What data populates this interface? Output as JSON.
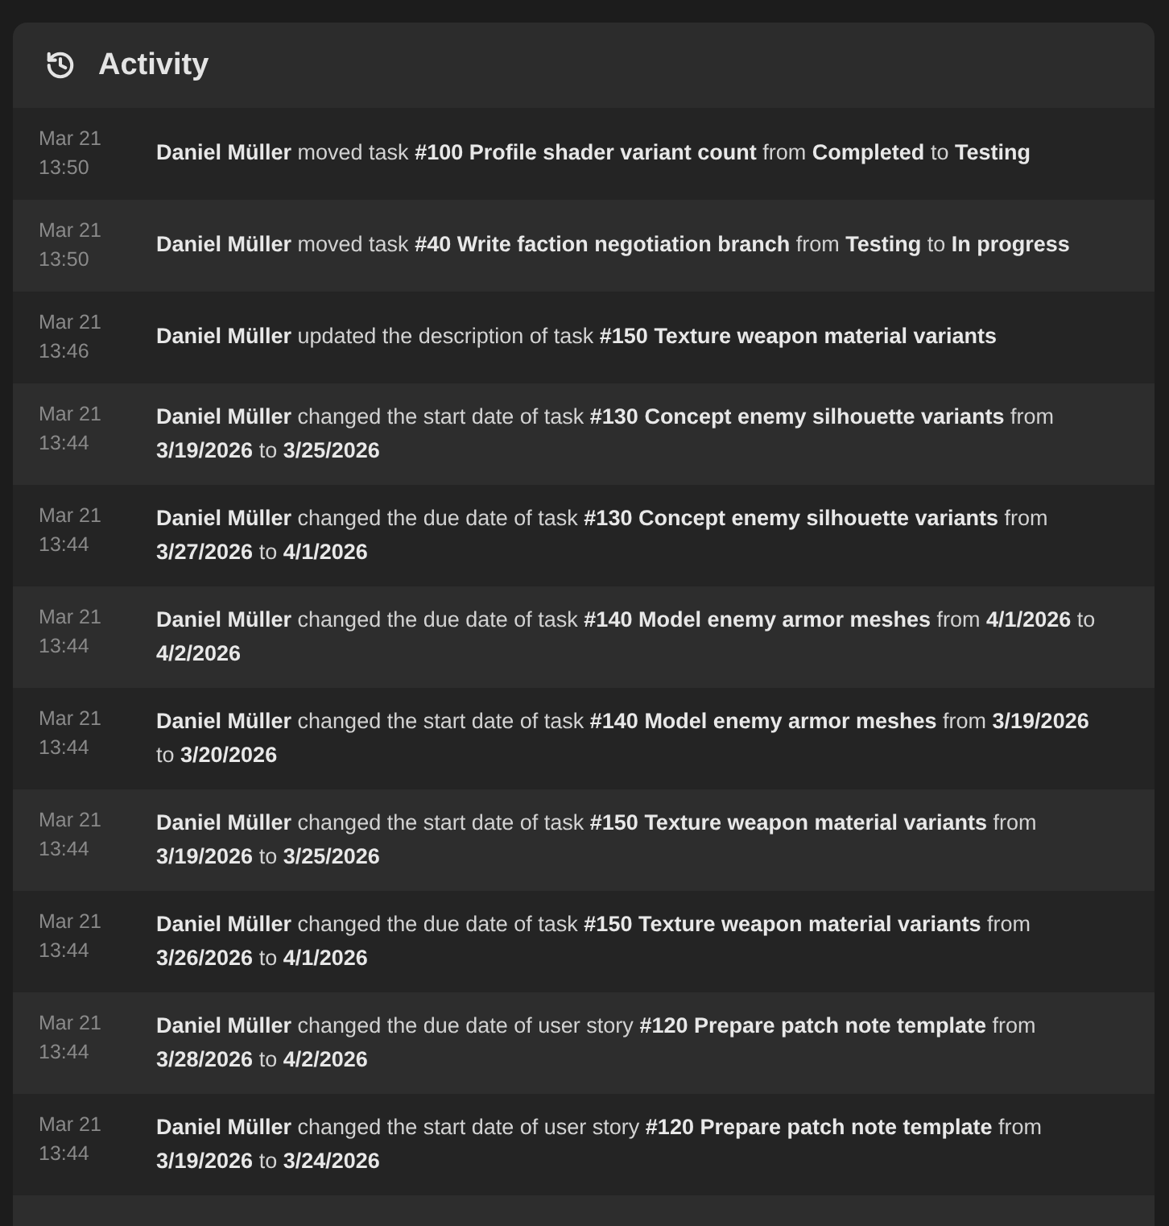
{
  "panel": {
    "title": "Activity"
  },
  "activity": [
    {
      "date": "Mar 21",
      "time": "13:50",
      "message": "**Daniel Müller** moved task **#100 Profile shader variant count** from **Completed** to **Testing**"
    },
    {
      "date": "Mar 21",
      "time": "13:50",
      "message": "**Daniel Müller** moved task **#40 Write faction negotiation branch** from **Testing** to **In progress**"
    },
    {
      "date": "Mar 21",
      "time": "13:46",
      "message": "**Daniel Müller** updated the description of task **#150 Texture weapon material variants**"
    },
    {
      "date": "Mar 21",
      "time": "13:44",
      "message": "**Daniel Müller** changed the start date of task **#130 Concept enemy silhouette variants** from **3/19/2026** to **3/25/2026**"
    },
    {
      "date": "Mar 21",
      "time": "13:44",
      "message": "**Daniel Müller** changed the due date of task **#130 Concept enemy silhouette variants** from **3/27/2026** to **4/1/2026**"
    },
    {
      "date": "Mar 21",
      "time": "13:44",
      "message": "**Daniel Müller** changed the due date of task **#140 Model enemy armor meshes** from **4/1/2026** to **4/2/2026**"
    },
    {
      "date": "Mar 21",
      "time": "13:44",
      "message": "**Daniel Müller** changed the start date of task **#140 Model enemy armor meshes** from **3/19/2026** to **3/20/2026**"
    },
    {
      "date": "Mar 21",
      "time": "13:44",
      "message": "**Daniel Müller** changed the start date of task **#150 Texture weapon material variants** from **3/19/2026** to **3/25/2026**"
    },
    {
      "date": "Mar 21",
      "time": "13:44",
      "message": "**Daniel Müller** changed the due date of task **#150 Texture weapon material variants** from **3/26/2026** to **4/1/2026**"
    },
    {
      "date": "Mar 21",
      "time": "13:44",
      "message": "**Daniel Müller** changed the due date of user story **#120 Prepare patch note template** from **3/28/2026** to **4/2/2026**"
    },
    {
      "date": "Mar 21",
      "time": "13:44",
      "message": "**Daniel Müller** changed the start date of user story **#120 Prepare patch note template** from **3/19/2026** to **3/24/2026**"
    }
  ]
}
